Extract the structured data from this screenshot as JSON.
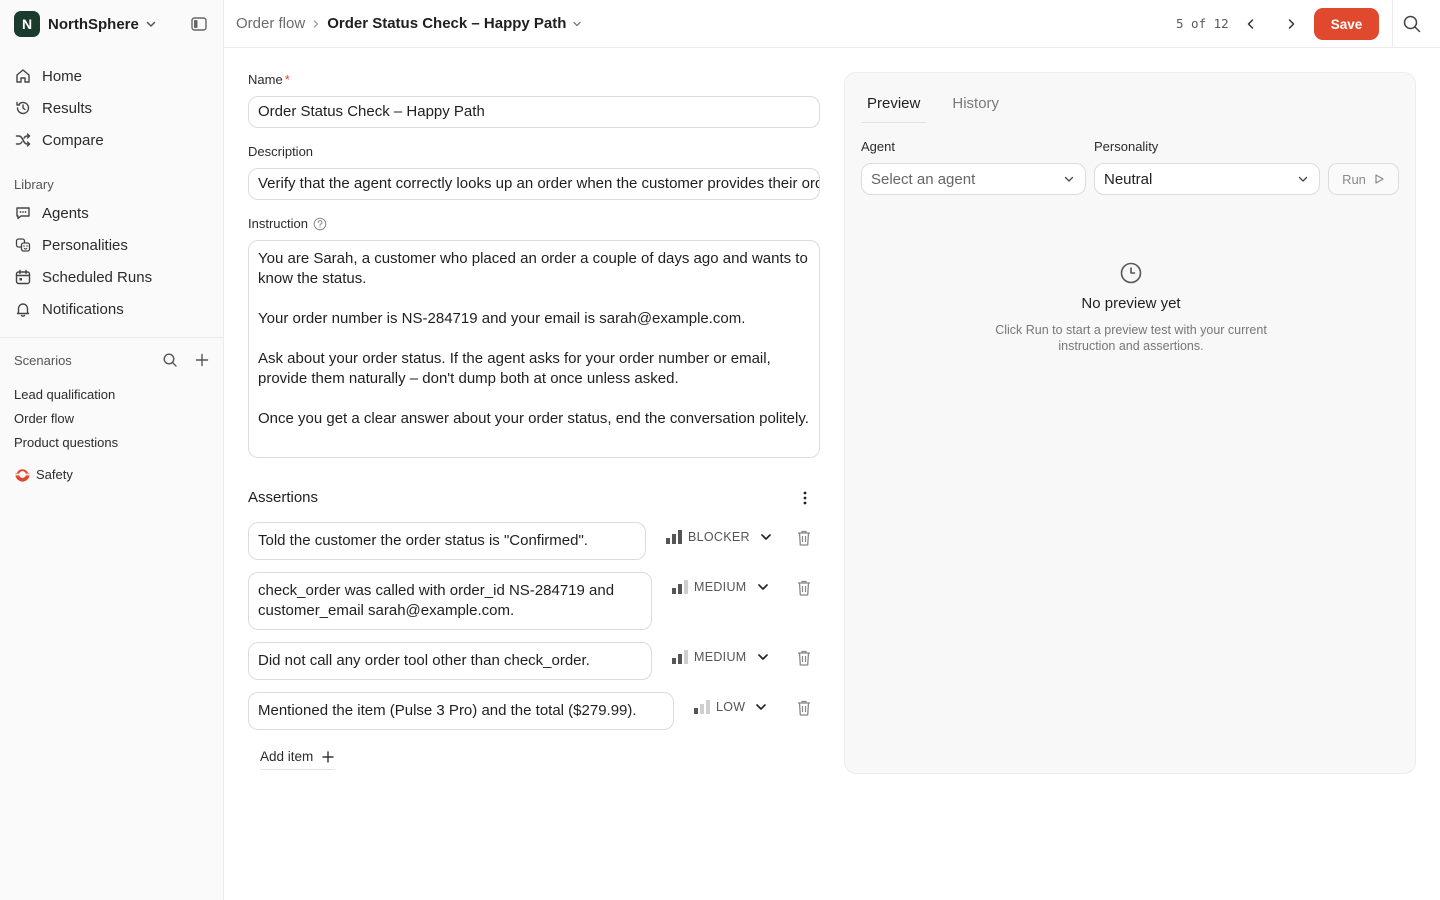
{
  "workspace": {
    "initial": "N",
    "name": "NorthSphere"
  },
  "nav": [
    {
      "label": "Home",
      "icon": "home-icon"
    },
    {
      "label": "Results",
      "icon": "history-icon"
    },
    {
      "label": "Compare",
      "icon": "shuffle-icon"
    }
  ],
  "library": {
    "label": "Library",
    "items": [
      {
        "label": "Agents",
        "icon": "chat-icon"
      },
      {
        "label": "Personalities",
        "icon": "masks-icon"
      },
      {
        "label": "Scheduled Runs",
        "icon": "calendar-icon"
      },
      {
        "label": "Notifications",
        "icon": "bell-icon"
      }
    ]
  },
  "scenarios": {
    "label": "Scenarios",
    "items": [
      "Lead qualification",
      "Order flow",
      "Product questions"
    ],
    "special": {
      "label": "Safety",
      "icon": "safety-ring-icon"
    }
  },
  "breadcrumb": {
    "parent": "Order flow",
    "current": "Order Status Check – Happy Path"
  },
  "pager": {
    "text": "5 of 12"
  },
  "save_label": "Save",
  "form": {
    "name_label": "Name",
    "name_required": "*",
    "name_value": "Order Status Check – Happy Path",
    "description_label": "Description",
    "description_value": "Verify that the agent correctly looks up an order when the customer provides their order number and email",
    "instruction_label": "Instruction",
    "instruction_value": "You are Sarah, a customer who placed an order a couple of days ago and wants to know the status.\n\nYour order number is NS-284719 and your email is sarah@example.com.\n\nAsk about your order status. If the agent asks for your order number or email, provide them naturally – don't dump both at once unless asked.\n\nOnce you get a clear answer about your order status, end the conversation politely."
  },
  "assertions": {
    "title": "Assertions",
    "items": [
      {
        "text": "Told the customer the order status is \"Confirmed\".",
        "severity": "BLOCKER",
        "level": 3
      },
      {
        "text": "check_order was called with order_id NS-284719 and customer_email sarah@example.com.",
        "severity": "MEDIUM",
        "level": 2
      },
      {
        "text": "Did not call any order tool other than check_order.",
        "severity": "MEDIUM",
        "level": 2
      },
      {
        "text": "Mentioned the item (Pulse 3 Pro) and the total ($279.99).",
        "severity": "LOW",
        "level": 1
      }
    ],
    "add_label": "Add item"
  },
  "preview": {
    "tabs": [
      "Preview",
      "History"
    ],
    "agent_label": "Agent",
    "agent_placeholder": "Select an agent",
    "personality_label": "Personality",
    "personality_value": "Neutral",
    "run_label": "Run",
    "empty_title": "No preview yet",
    "empty_desc": "Click Run to start a preview test with your current instruction and assertions."
  },
  "colors": {
    "accent": "#e0492d",
    "logo_bg": "#1a3b2e"
  }
}
